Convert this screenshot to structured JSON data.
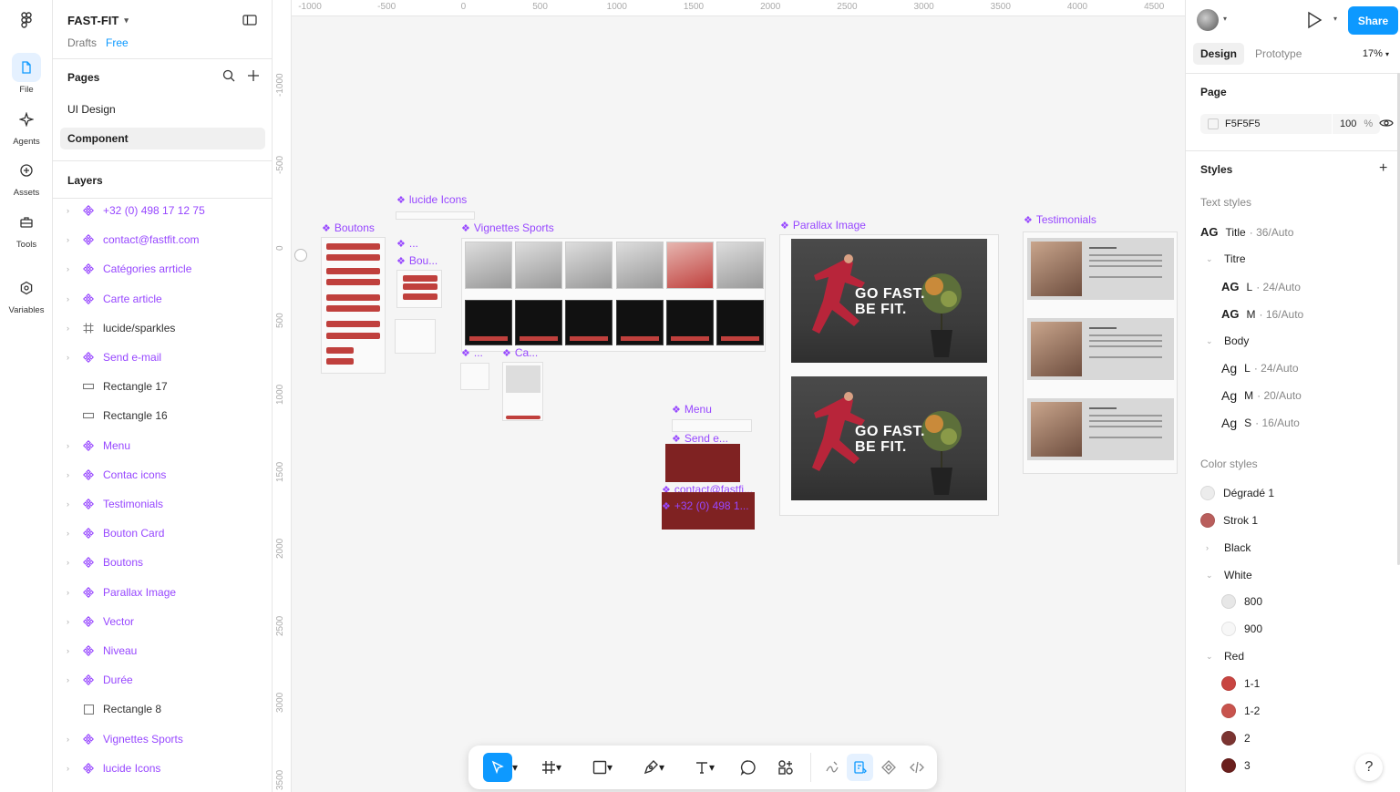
{
  "rail": {
    "items": [
      {
        "label": "File"
      },
      {
        "label": "Agents"
      },
      {
        "label": "Assets"
      },
      {
        "label": "Tools"
      },
      {
        "label": "Variables"
      }
    ]
  },
  "file": {
    "name": "FAST-FIT",
    "location": "Drafts",
    "plan": "Free"
  },
  "pages": {
    "title": "Pages",
    "items": [
      {
        "label": "UI Design"
      },
      {
        "label": "Component"
      }
    ]
  },
  "layers": {
    "title": "Layers",
    "items": [
      {
        "label": "+32 (0) 498 17 12 75",
        "kind": "component"
      },
      {
        "label": "contact@fastfit.com",
        "kind": "component"
      },
      {
        "label": "Catégories arrticle",
        "kind": "component"
      },
      {
        "label": "Carte article",
        "kind": "component"
      },
      {
        "label": "lucide/sparkles",
        "kind": "frame"
      },
      {
        "label": "Send e-mail",
        "kind": "component"
      },
      {
        "label": "Rectangle 17",
        "kind": "rect"
      },
      {
        "label": "Rectangle 16",
        "kind": "rect"
      },
      {
        "label": "Menu",
        "kind": "component"
      },
      {
        "label": "Contac icons",
        "kind": "component"
      },
      {
        "label": "Testimonials",
        "kind": "component"
      },
      {
        "label": "Bouton Card",
        "kind": "component"
      },
      {
        "label": "Boutons",
        "kind": "component"
      },
      {
        "label": "Parallax Image",
        "kind": "component"
      },
      {
        "label": "Vector",
        "kind": "component"
      },
      {
        "label": "Niveau",
        "kind": "component"
      },
      {
        "label": "Durée",
        "kind": "component"
      },
      {
        "label": "Rectangle 8",
        "kind": "square"
      },
      {
        "label": "Vignettes Sports",
        "kind": "component"
      },
      {
        "label": "lucide Icons",
        "kind": "component"
      }
    ]
  },
  "canvas": {
    "ruler_x": [
      "-1000",
      "-500",
      "0",
      "500",
      "1000",
      "1500",
      "2000",
      "2500",
      "3000",
      "3500",
      "4000",
      "4500"
    ],
    "ruler_y": [
      "-1000",
      "-500",
      "0",
      "500",
      "1000",
      "1500",
      "2000",
      "2500",
      "3000",
      "3500"
    ],
    "frames": {
      "lucide_icons": "lucide Icons",
      "boutons": "Boutons",
      "vignettes": "Vignettes Sports",
      "parallax": "Parallax Image",
      "testimonials": "Testimonials",
      "dots": "...",
      "bou": "Bou...",
      "dots2": "...",
      "ca": "Ca...",
      "menu": "Menu",
      "send": "Send e...",
      "contact": "contact@fastfi...",
      "phone": "+32 (0) 498 1..."
    },
    "hero_text_1": "GO FAST.",
    "hero_text_2": "BE FIT."
  },
  "right": {
    "share": "Share",
    "tabs": [
      {
        "label": "Design"
      },
      {
        "label": "Prototype"
      }
    ],
    "zoom": "17%",
    "page_section": "Page",
    "page_color": "F5F5F5",
    "page_opacity": "100",
    "page_pct": "%",
    "styles_title": "Styles",
    "text_styles_label": "Text styles",
    "text_styles": {
      "title": {
        "ag": "AG",
        "name": "Title",
        "meta": "· 36/Auto"
      },
      "titre_group": "Titre",
      "titre_l": {
        "ag": "AG",
        "name": "L",
        "meta": "· 24/Auto"
      },
      "titre_m": {
        "ag": "AG",
        "name": "M",
        "meta": "· 16/Auto"
      },
      "body_group": "Body",
      "body_l": {
        "ag": "Ag",
        "name": "L",
        "meta": "· 24/Auto"
      },
      "body_m": {
        "ag": "Ag",
        "name": "M",
        "meta": "· 20/Auto"
      },
      "body_s": {
        "ag": "Ag",
        "name": "S",
        "meta": "· 16/Auto"
      }
    },
    "color_styles_label": "Color styles",
    "colors": {
      "degrade": {
        "name": "Dégradé 1",
        "hex": "#ececec"
      },
      "strok": {
        "name": "Strok 1",
        "hex": "#b95e5c"
      },
      "black_group": "Black",
      "white_group": "White",
      "w800": {
        "name": "800",
        "hex": "#e7e7e7"
      },
      "w900": {
        "name": "900",
        "hex": "#f7f7f7"
      },
      "red_group": "Red",
      "r11": {
        "name": "1-1",
        "hex": "#c84541"
      },
      "r12": {
        "name": "1-2",
        "hex": "#c8534d"
      },
      "r2": {
        "name": "2",
        "hex": "#7b3431"
      },
      "r3": {
        "name": "3",
        "hex": "#6a1f1d"
      }
    },
    "help": "?"
  },
  "accent": "#0d99ff",
  "component_color": "#9747ff"
}
